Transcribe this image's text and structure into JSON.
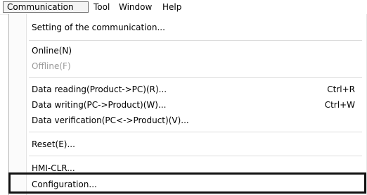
{
  "menubar": {
    "items": [
      {
        "label": "Communication"
      },
      {
        "label": "Tool"
      },
      {
        "label": "Window"
      },
      {
        "label": "Help"
      }
    ]
  },
  "menu": {
    "items": [
      {
        "label": "Setting of the communication...",
        "shortcut": "",
        "enabled": true
      },
      {
        "label": "Online(N)",
        "shortcut": "",
        "enabled": true
      },
      {
        "label": "Offline(F)",
        "shortcut": "",
        "enabled": false
      },
      {
        "label": "Data reading(Product->PC)(R)...",
        "shortcut": "Ctrl+R",
        "enabled": true
      },
      {
        "label": "Data writing(PC->Product)(W)...",
        "shortcut": "Ctrl+W",
        "enabled": true
      },
      {
        "label": "Data verification(PC<->Product)(V)...",
        "shortcut": "",
        "enabled": true
      },
      {
        "label": "Reset(E)...",
        "shortcut": "",
        "enabled": true
      },
      {
        "label": "HMI-CLR...",
        "shortcut": "",
        "enabled": true
      },
      {
        "label": "Configuration...",
        "shortcut": "",
        "enabled": true,
        "highlighted": true
      }
    ]
  },
  "colors": {
    "disabled_text": "#9a9a9a",
    "highlight_border": "#111111",
    "separator": "#dcdcdc"
  }
}
